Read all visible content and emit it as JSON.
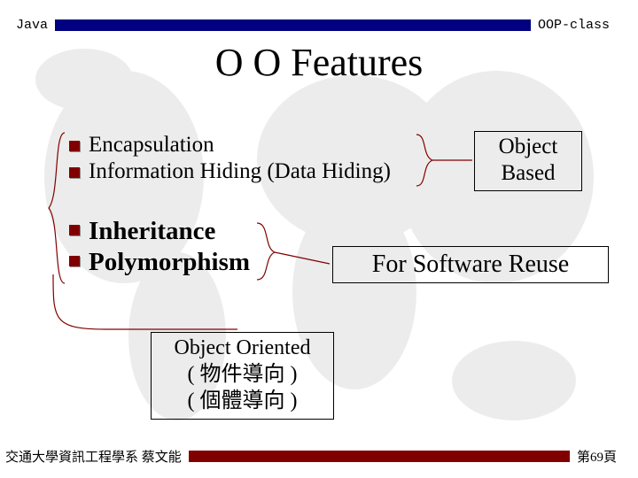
{
  "header": {
    "left": "Java",
    "right": "OOP-class"
  },
  "title": "O O Features",
  "bullets": {
    "b1": "Encapsulation",
    "b2": "Information Hiding (Data Hiding)",
    "b3": "Inheritance",
    "b4": "Polymorphism"
  },
  "boxes": {
    "object_based_l1": "Object",
    "object_based_l2": "Based",
    "software_reuse": "For Software Reuse",
    "oo_l1": "Object Oriented",
    "oo_l2": "( 物件導向 )",
    "oo_l3": "( 個體導向 )"
  },
  "footer": {
    "left": "交通大學資訊工程學系  蔡文能",
    "right": "第69頁"
  }
}
